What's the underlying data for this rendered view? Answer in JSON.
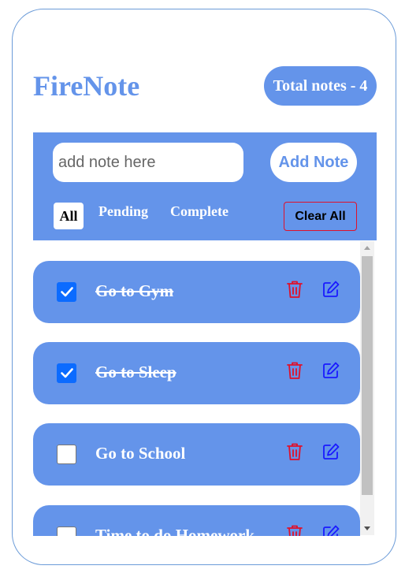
{
  "app": {
    "title": "FireNote",
    "total_label": "Total notes - 4"
  },
  "controls": {
    "input_placeholder": "add note here",
    "input_value": "",
    "add_label": "Add Note",
    "filters": {
      "all": "All",
      "pending": "Pending",
      "complete": "Complete"
    },
    "selected_filter": "All",
    "clear_label": "Clear All"
  },
  "notes": [
    {
      "text": "Go to Gym",
      "completed": true
    },
    {
      "text": "Go to Sleep",
      "completed": true
    },
    {
      "text": "Go to School",
      "completed": false
    },
    {
      "text": "Time to do Homework",
      "completed": false
    }
  ],
  "colors": {
    "accent": "#6494ea",
    "checkbox_checked": "#0b6bff",
    "delete": "#e0102a",
    "edit": "#1a1aff"
  },
  "icons": {
    "delete": "trash-icon",
    "edit": "edit-icon",
    "checked": "check-icon"
  }
}
